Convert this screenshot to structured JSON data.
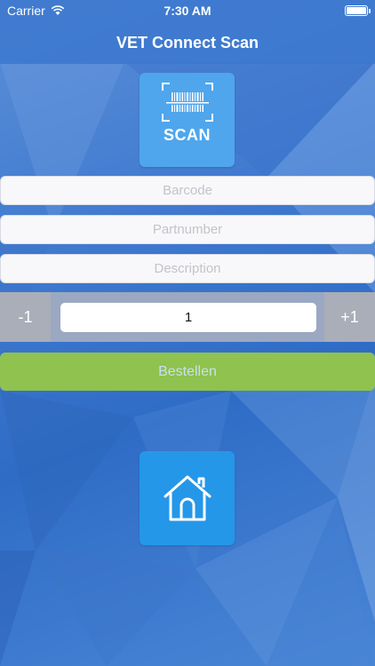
{
  "status_bar": {
    "carrier": "Carrier",
    "time": "7:30 AM"
  },
  "nav": {
    "title": "VET Connect Scan"
  },
  "scan_button": {
    "label": "SCAN",
    "icon": "barcode-scan-icon"
  },
  "fields": {
    "barcode_placeholder": "Barcode",
    "barcode_value": "",
    "partnumber_placeholder": "Partnumber",
    "partnumber_value": "",
    "description_placeholder": "Description",
    "description_value": ""
  },
  "quantity": {
    "minus_label": "-1",
    "plus_label": "+1",
    "value": "1"
  },
  "order_button": {
    "label": "Bestellen"
  },
  "home_button": {
    "icon": "home-icon"
  },
  "colors": {
    "accent_blue": "#2597e8",
    "scan_blue": "#4fa6ec",
    "order_green": "#8fc24e"
  }
}
